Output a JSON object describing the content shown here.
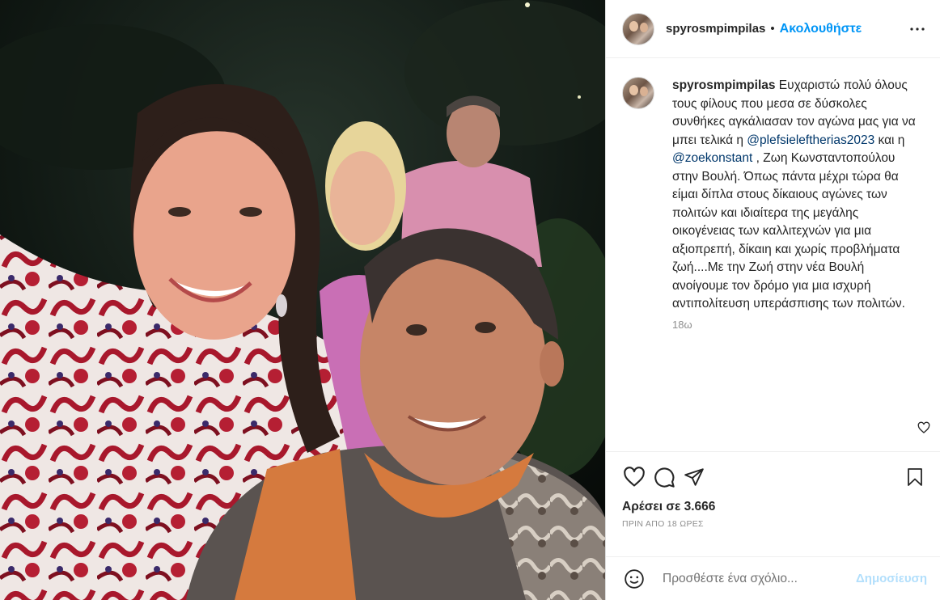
{
  "post": {
    "username": "spyrosmpimpilas",
    "follow_label": "Ακολουθήστε",
    "separator": "•"
  },
  "caption": {
    "username": "spyrosmpimpilas",
    "text_1": " Ευχαριστώ πολύ όλους τους φίλους που μεσα σε δύσκολες συνθήκες αγκάλιασαν τον αγώνα μας για να μπει τελικά η ",
    "mention_1": "@plefsieleftherias2023",
    "text_2": " και η ",
    "mention_2": "@zoekonstant",
    "text_3": " , Ζωη Κωνσταντοπούλου στην Βουλή. Όπως πάντα μέχρι τώρα θα είμαι δίπλα στους δίκαιους αγώνες των πολιτών και ιδιαίτερα της μεγάλης οικογένειας των καλλιτεχνών για μια αξιοπρεπή, δίκαιη και χωρίς προβλήματα ζωή....Με την Ζωή στην νέα Βουλή ανοίγουμε τον δρόμο για μια ισχυρή αντιπολίτευση υπεράσπισης των πολιτών.",
    "age": "18ω"
  },
  "engagement": {
    "likes_label": "Αρέσει σε 3.666",
    "posted_ago": "ΠΡΙΝ ΑΠΟ 18 ΩΡΕΣ"
  },
  "comment_box": {
    "placeholder": "Προσθέστε ένα σχόλιο...",
    "post_label": "Δημοσίευση"
  },
  "icons": {
    "more": "more-horizontal-icon",
    "heart": "heart-icon",
    "comment": "comment-icon",
    "share": "share-paper-plane-icon",
    "save": "bookmark-icon",
    "emoji": "emoji-smile-icon"
  },
  "colors": {
    "accent": "#0095f6",
    "mention": "#00376b",
    "muted": "#8e8e8e",
    "post_disabled": "#b2dffc"
  }
}
